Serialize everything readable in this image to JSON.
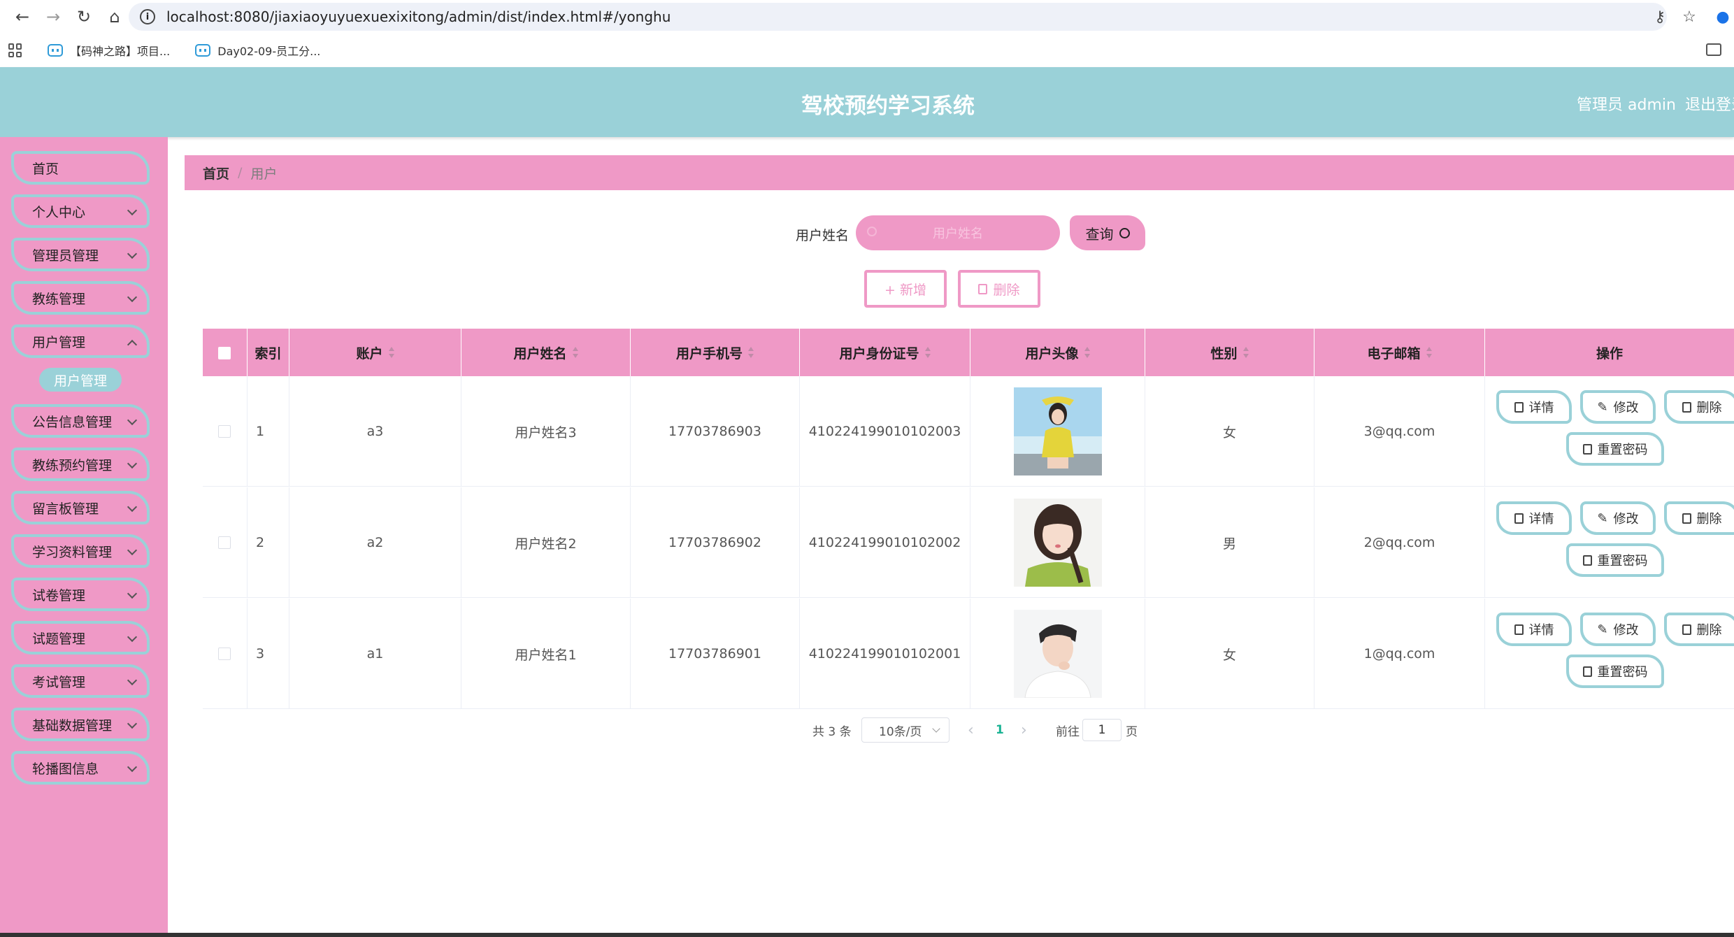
{
  "browser": {
    "url": "localhost:8080/jiaxiaoyuyuexuexixitong/admin/dist/index.html#/yonghu",
    "bookmarks": [
      {
        "label": "【码神之路】项目..."
      },
      {
        "label": "Day02-09-员工分..."
      }
    ]
  },
  "header": {
    "title": "驾校预约学习系统",
    "user": "管理员 admin",
    "logout": "退出登录"
  },
  "sidebar": {
    "items": [
      {
        "label": "首页",
        "expandable": false
      },
      {
        "label": "个人中心",
        "expandable": true
      },
      {
        "label": "管理员管理",
        "expandable": true
      },
      {
        "label": "教练管理",
        "expandable": true
      },
      {
        "label": "用户管理",
        "expandable": true
      },
      {
        "label": "公告信息管理",
        "expandable": true
      },
      {
        "label": "教练预约管理",
        "expandable": true
      },
      {
        "label": "留言板管理",
        "expandable": true
      },
      {
        "label": "学习资料管理",
        "expandable": true
      },
      {
        "label": "试卷管理",
        "expandable": true
      },
      {
        "label": "试题管理",
        "expandable": true
      },
      {
        "label": "考试管理",
        "expandable": true
      },
      {
        "label": "基础数据管理",
        "expandable": true
      },
      {
        "label": "轮播图信息",
        "expandable": true
      }
    ],
    "active_sub": "用户管理"
  },
  "breadcrumb": {
    "home": "首页",
    "separator": "/",
    "current": "用户"
  },
  "search": {
    "label": "用户姓名",
    "placeholder": "用户姓名",
    "button": "查询"
  },
  "actions": {
    "add": "+ 新增",
    "delete": "删除"
  },
  "table": {
    "columns": [
      "索引",
      "账户",
      "用户姓名",
      "用户手机号",
      "用户身份证号",
      "用户头像",
      "性别",
      "电子邮箱",
      "操作"
    ],
    "rows": [
      {
        "index": "1",
        "account": "a3",
        "name": "用户姓名3",
        "phone": "17703786903",
        "idcard": "410224199010102003",
        "gender": "女",
        "email": "3@qq.com"
      },
      {
        "index": "2",
        "account": "a2",
        "name": "用户姓名2",
        "phone": "17703786902",
        "idcard": "410224199010102002",
        "gender": "男",
        "email": "2@qq.com"
      },
      {
        "index": "3",
        "account": "a1",
        "name": "用户姓名1",
        "phone": "17703786901",
        "idcard": "410224199010102001",
        "gender": "女",
        "email": "1@qq.com"
      }
    ],
    "row_actions": {
      "detail": "详情",
      "edit": "修改",
      "delete": "删除",
      "reset_password": "重置密码"
    }
  },
  "pagination": {
    "total": "共 3 条",
    "page_size": "10条/页",
    "prev": "‹",
    "current_page": "1",
    "next": "›",
    "goto_label": "前往",
    "goto_value": "1",
    "page_unit": "页"
  },
  "colors": {
    "pink": "#ef99c6",
    "teal": "#9ad1d8",
    "accent_page": "#1bb394"
  }
}
